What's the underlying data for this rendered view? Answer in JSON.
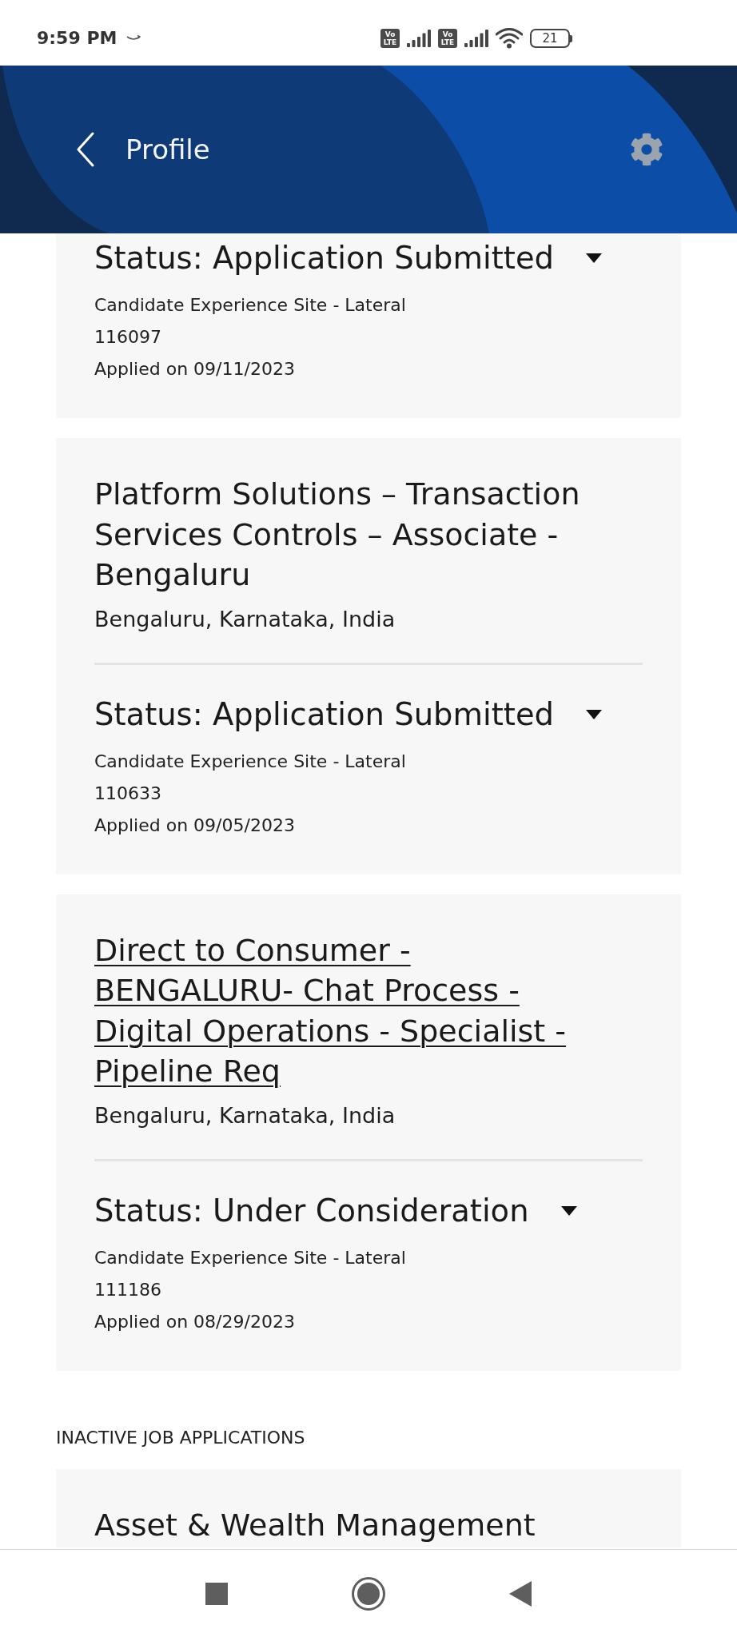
{
  "status_bar": {
    "time": "9:59 PM",
    "sim_badges": [
      "Vo LTE",
      "Vo LTE"
    ],
    "battery": "21"
  },
  "header": {
    "title": "Profile"
  },
  "active_applications": [
    {
      "status": "Status: Application Submitted",
      "expanded": false,
      "site": "Candidate Experience Site - Lateral",
      "req_id": "116097",
      "applied": "Applied on 09/11/2023"
    },
    {
      "title": "Platform Solutions – Transaction Services Controls – Associate - Bengaluru",
      "link": false,
      "location": "Bengaluru, Karnataka, India",
      "status": "Status: Application Submitted",
      "expanded": false,
      "site": "Candidate Experience Site - Lateral",
      "req_id": "110633",
      "applied": "Applied on 09/05/2023"
    },
    {
      "title": "Direct to Consumer - BENGALURU- Chat Process - Digital Operations - Specialist - Pipeline Req",
      "link": true,
      "location": "Bengaluru, Karnataka, India",
      "status": "Status: Under Consideration",
      "expanded": false,
      "site": "Candidate Experience Site - Lateral",
      "req_id": "111186",
      "applied": "Applied on 08/29/2023"
    }
  ],
  "inactive_section": {
    "heading": "INACTIVE JOB APPLICATIONS",
    "applications": [
      {
        "title": "Asset & Wealth Management",
        "link": false
      }
    ]
  }
}
